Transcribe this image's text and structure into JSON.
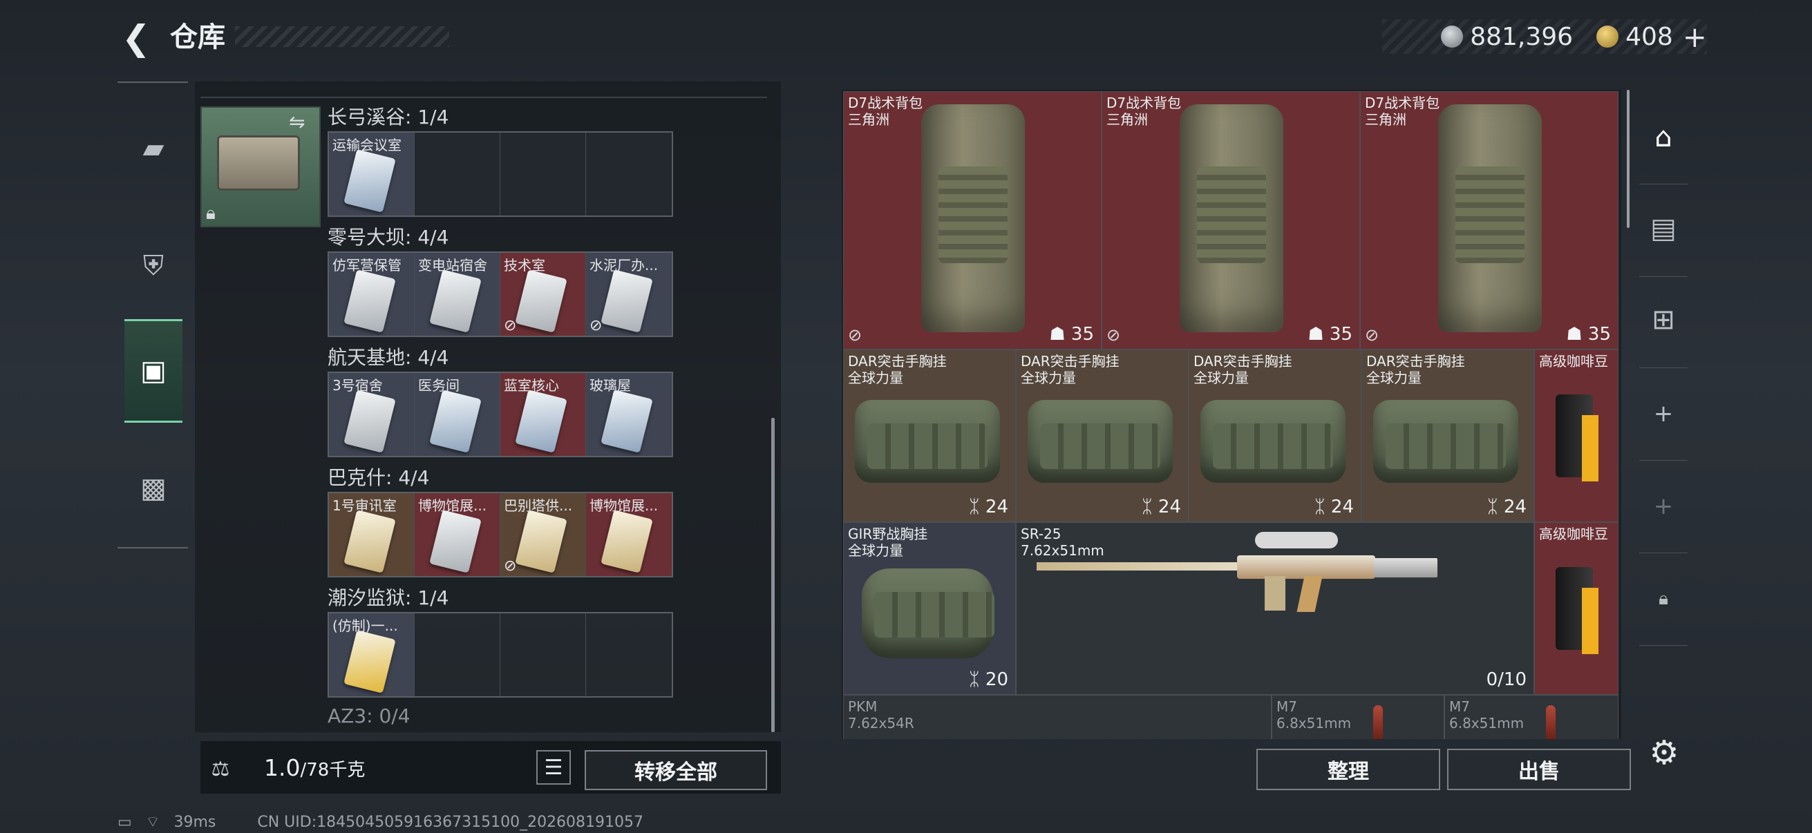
{
  "header": {
    "title": "仓库",
    "back_icon": "back-arrow-icon"
  },
  "currency": {
    "silver": "881,396",
    "gold": "408",
    "add": "+"
  },
  "nav": {
    "items": [
      "weapon-icon",
      "armor-icon",
      "backpack-icon",
      "toolbox-icon"
    ],
    "active_index": 2
  },
  "container": {
    "sections": [
      {
        "header": "长弓溪谷: 1/4",
        "cells": [
          {
            "label": "运输会议室",
            "style": "filled",
            "card": "blue",
            "crossed": false
          },
          {
            "label": "",
            "style": "empty"
          },
          {
            "label": "",
            "style": "empty"
          },
          {
            "label": "",
            "style": "empty"
          }
        ]
      },
      {
        "header": "零号大坝: 4/4",
        "cells": [
          {
            "label": "仿军营保管",
            "style": "filled",
            "card": "white",
            "crossed": false
          },
          {
            "label": "变电站宿舍",
            "style": "filled",
            "card": "white",
            "crossed": false
          },
          {
            "label": "技术室",
            "style": "red",
            "card": "white",
            "crossed": true
          },
          {
            "label": "水泥厂办...",
            "style": "filled",
            "card": "white",
            "crossed": true
          }
        ]
      },
      {
        "header": "航天基地: 4/4",
        "cells": [
          {
            "label": "3号宿舍",
            "style": "filled",
            "card": "white",
            "crossed": false
          },
          {
            "label": "医务间",
            "style": "filled",
            "card": "blue",
            "crossed": false
          },
          {
            "label": "蓝室核心",
            "style": "red",
            "card": "blue",
            "crossed": false
          },
          {
            "label": "玻璃屋",
            "style": "filled",
            "card": "blue",
            "crossed": false
          }
        ]
      },
      {
        "header": "巴克什: 4/4",
        "cells": [
          {
            "label": "1号审讯室",
            "style": "brown",
            "card": "gold",
            "crossed": false
          },
          {
            "label": "博物馆展...",
            "style": "red",
            "card": "white",
            "crossed": false
          },
          {
            "label": "巴别塔供...",
            "style": "brown",
            "card": "gold",
            "crossed": true
          },
          {
            "label": "博物馆展...",
            "style": "red",
            "card": "gold",
            "crossed": false
          }
        ]
      },
      {
        "header": "潮汐监狱: 1/4",
        "cells": [
          {
            "label": "(仿制)一...",
            "style": "filled",
            "card": "yellow",
            "crossed": false
          },
          {
            "label": "",
            "style": "empty"
          },
          {
            "label": "",
            "style": "empty"
          },
          {
            "label": "",
            "style": "empty"
          }
        ]
      }
    ],
    "next_header": "AZ3: 0/4"
  },
  "weight": {
    "value": "1.0",
    "unit": "/78千克",
    "kg_icon": "KG"
  },
  "buttons": {
    "transfer_all": "转移全部",
    "tidy": "整理",
    "sell": "出售"
  },
  "status": {
    "ping": "39ms",
    "uid": "CN UID:1845045059163673151​00_202608191057"
  },
  "stash": {
    "backpacks": [
      {
        "name": "D7战术背包",
        "sub": "三角洲",
        "count": "35"
      },
      {
        "name": "D7战术背包",
        "sub": "三角洲",
        "count": "35"
      },
      {
        "name": "D7战术背包",
        "sub": "三角洲",
        "count": "35"
      }
    ],
    "rigs": [
      {
        "name": "DAR突击手胸挂",
        "sub": "全球力量",
        "count": "24"
      },
      {
        "name": "DAR突击手胸挂",
        "sub": "全球力量",
        "count": "24"
      },
      {
        "name": "DAR突击手胸挂",
        "sub": "全球力量",
        "count": "24"
      },
      {
        "name": "DAR突击手胸挂",
        "sub": "全球力量",
        "count": "24"
      }
    ],
    "coffee": [
      {
        "name": "高级咖啡豆"
      },
      {
        "name": "高级咖啡豆"
      }
    ],
    "gir": {
      "name": "GIR野战胸挂",
      "sub": "全球力量",
      "count": "20"
    },
    "rifle": {
      "name": "SR-25",
      "sub": "7.62x51mm",
      "count": "0/10"
    },
    "pkm": {
      "name": "PKM",
      "sub": "7.62x54R"
    },
    "m7a": {
      "name": "M7",
      "sub": "6.8x51mm"
    },
    "m7b": {
      "name": "M7",
      "sub": "6.8x51mm"
    }
  },
  "colors": {
    "maroon": "#6b2f33",
    "olive": "#54463a",
    "steel": "#383d49",
    "accent": "#7bd2a8"
  }
}
